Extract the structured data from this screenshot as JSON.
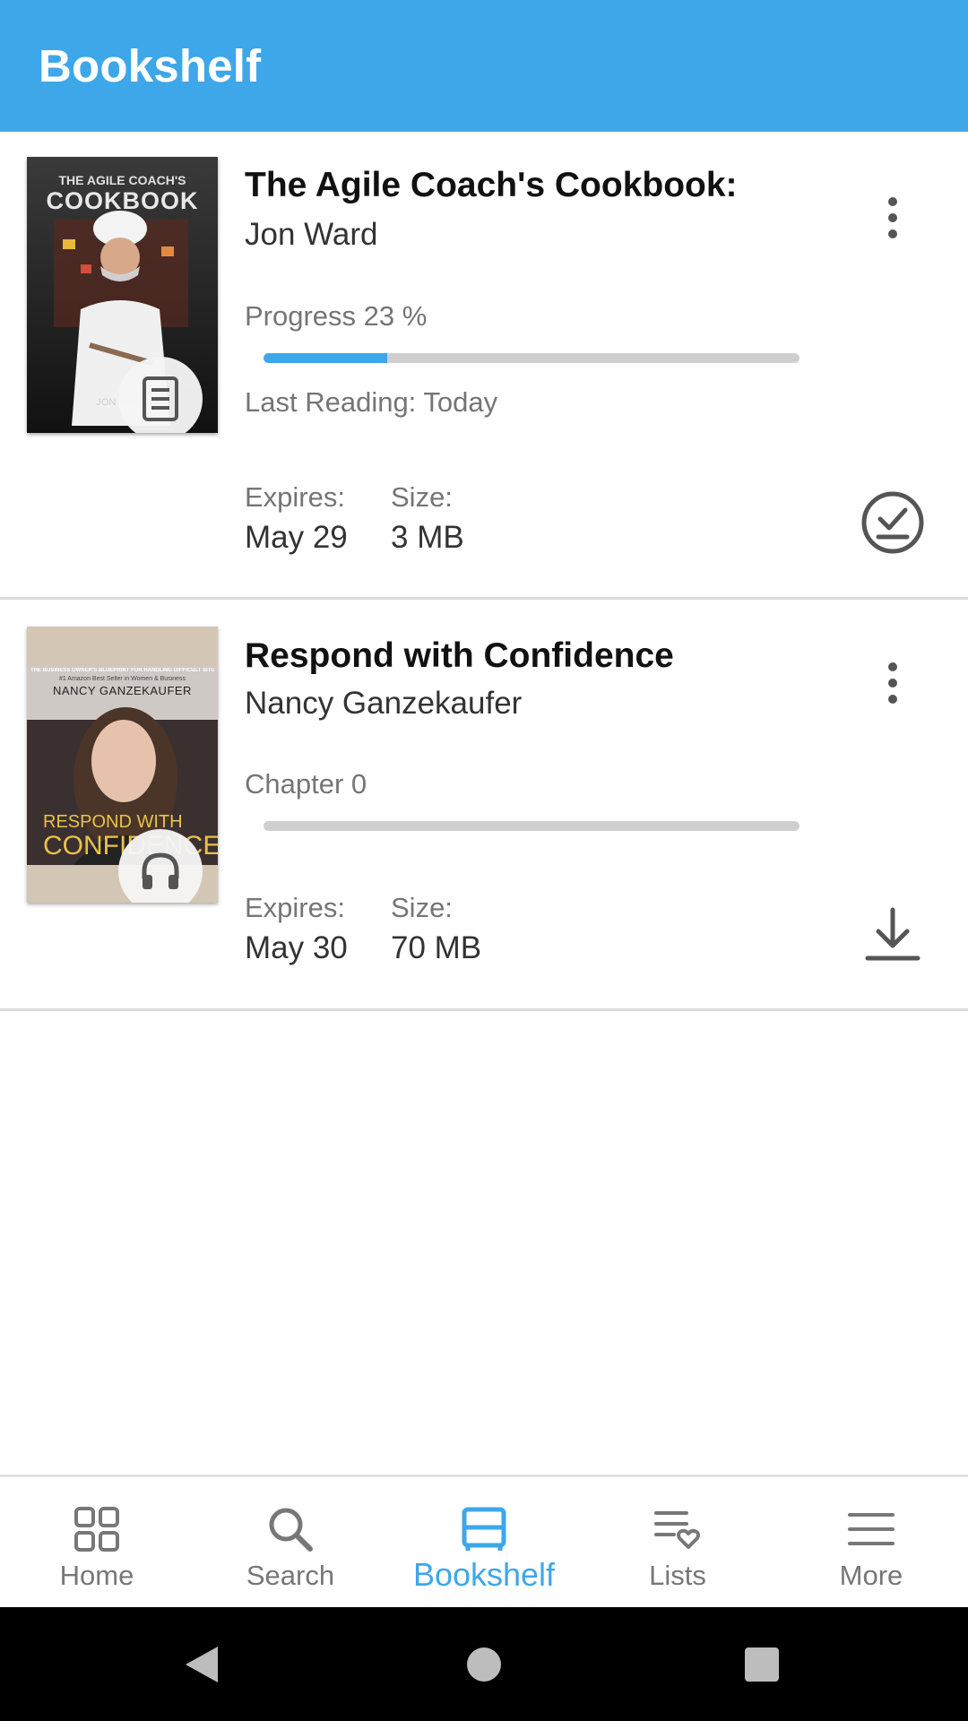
{
  "app": {
    "title": "Bookshelf"
  },
  "books": [
    {
      "title": "The Agile Coach's Cookbook:",
      "author": "Jon Ward",
      "cover_lines": [
        "THE AGILE COACH'S",
        "COOKBOOK",
        "JON WARD"
      ],
      "format_icon": "ebook-icon",
      "progress_label": "Progress 23 %",
      "progress": 0.23,
      "last_reading": "Last Reading: Today",
      "expires_label": "Expires:",
      "expires": "May 29",
      "size_label": "Size:",
      "size": "3 MB",
      "action_icon": "downloaded-check-icon"
    },
    {
      "title": "Respond with Confidence",
      "author": "Nancy Ganzekaufer",
      "cover_lines": [
        "THE BUSINESS OWNER'S BLUEPRINT FOR HANDLING DIFFICULT SITUATIONS",
        "#1 Amazon Best Seller in Women & Business",
        "NANCY GANZEKAUFER",
        "RESPOND WITH",
        "CONFIDENCE"
      ],
      "format_icon": "headphones-icon",
      "progress_label": "Chapter 0",
      "progress": 0,
      "expires_label": "Expires:",
      "expires": "May 30",
      "size_label": "Size:",
      "size": "70 MB",
      "action_icon": "download-icon"
    }
  ],
  "bottom_nav": [
    {
      "label": "Home",
      "icon": "grid-icon",
      "active": false
    },
    {
      "label": "Search",
      "icon": "search-icon",
      "active": false
    },
    {
      "label": "Bookshelf",
      "icon": "bookshelf-icon",
      "active": true
    },
    {
      "label": "Lists",
      "icon": "list-heart-icon",
      "active": false
    },
    {
      "label": "More",
      "icon": "hamburger-icon",
      "active": false
    }
  ],
  "colors": {
    "accent": "#3ea7e9",
    "inactive": "#777777",
    "track": "#cfcfcf"
  }
}
